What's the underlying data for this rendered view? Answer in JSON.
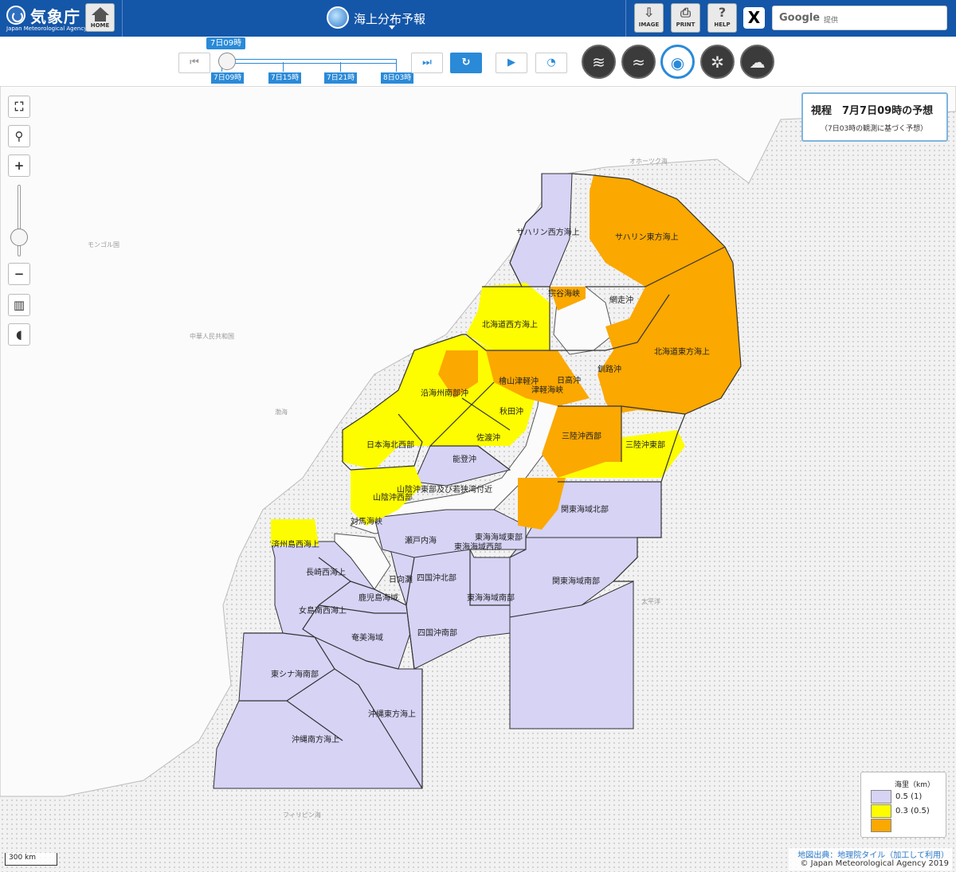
{
  "header": {
    "logo_jp": "気象庁",
    "logo_en": "Japan Meteorological Agency",
    "home_label": "HOME",
    "product_title": "海上分布予報",
    "tools": [
      {
        "name": "image-button",
        "label": "IMAGE",
        "glyph": "⇩"
      },
      {
        "name": "print-button",
        "label": "PRINT",
        "glyph": "⎙"
      },
      {
        "name": "help-button",
        "label": "HELP",
        "glyph": "?"
      }
    ],
    "x_label": "X",
    "search_brand": "Google",
    "search_suffix": "提供"
  },
  "timeline": {
    "current": "7日09時",
    "ticks": [
      "7日09時",
      "7日15時",
      "7日21時",
      "8日03時"
    ]
  },
  "elements": [
    {
      "name": "wind-element-button",
      "icon": "wind-icon",
      "glyph": "≋"
    },
    {
      "name": "wave-element-button",
      "icon": "wave-icon",
      "glyph": "≈"
    },
    {
      "name": "visibility-element-button",
      "icon": "eye-icon",
      "glyph": "◉"
    },
    {
      "name": "icing-element-button",
      "icon": "snowflake-icon",
      "glyph": "✲"
    },
    {
      "name": "weather-element-button",
      "icon": "cloud-sun-icon",
      "glyph": "☁"
    }
  ],
  "info": {
    "title": "視程　7月7日09時の予想",
    "subtitle": "（7日03時の観測に基づく予想）"
  },
  "legend": {
    "title": "海里（km）",
    "items": [
      {
        "label": "0.5 (1)",
        "color": "#d6d3f5"
      },
      {
        "label": "0.3 (0.5)",
        "color": "#fdfd00"
      },
      {
        "label": "",
        "color": "#fba800"
      }
    ]
  },
  "legend_labels": [
    "0.5 (1)",
    "0.3 (0.5)"
  ],
  "colors": {
    "lavender": "#d6d3f5",
    "yellow": "#fdfd00",
    "orange": "#fba800",
    "border": "#333333"
  },
  "sea_areas": [
    "サハリン西方海上",
    "サハリン東方海上",
    "宗谷海峡",
    "網走沖",
    "北海道西方海上",
    "北海道東方海上",
    "檜山津軽沖",
    "日高沖",
    "津軽海峡",
    "釧路沖",
    "沿海州南部沖",
    "秋田沖",
    "三陸沖西部",
    "三陸沖東部",
    "佐渡沖",
    "日本海北西部",
    "能登沖",
    "山陰沖東部及び若狭湾付近",
    "山陰沖西部",
    "関東海域北部",
    "対馬海峡",
    "済州島西海上",
    "瀬戸内海",
    "東海海域東部",
    "東海海域西部",
    "関東海域南部",
    "長崎西海上",
    "日向灘",
    "四国沖北部",
    "東海海域南部",
    "鹿児島海域",
    "女島南西海上",
    "奄美海域",
    "四国沖南部",
    "東シナ海南部",
    "沖縄東方海上",
    "沖縄南方海上"
  ],
  "background_labels": [
    "オホーツク海",
    "中華人民共和国",
    "太平洋",
    "フィリピン海",
    "渤海",
    "モンゴル国"
  ],
  "map_controls": {
    "zoom_in": "+",
    "zoom_out": "−"
  },
  "attribution": {
    "source": "地図出典：地理院タイル（加工して利用）",
    "copyright": "© Japan Meteorological Agency 2019"
  },
  "scale": "300 km"
}
